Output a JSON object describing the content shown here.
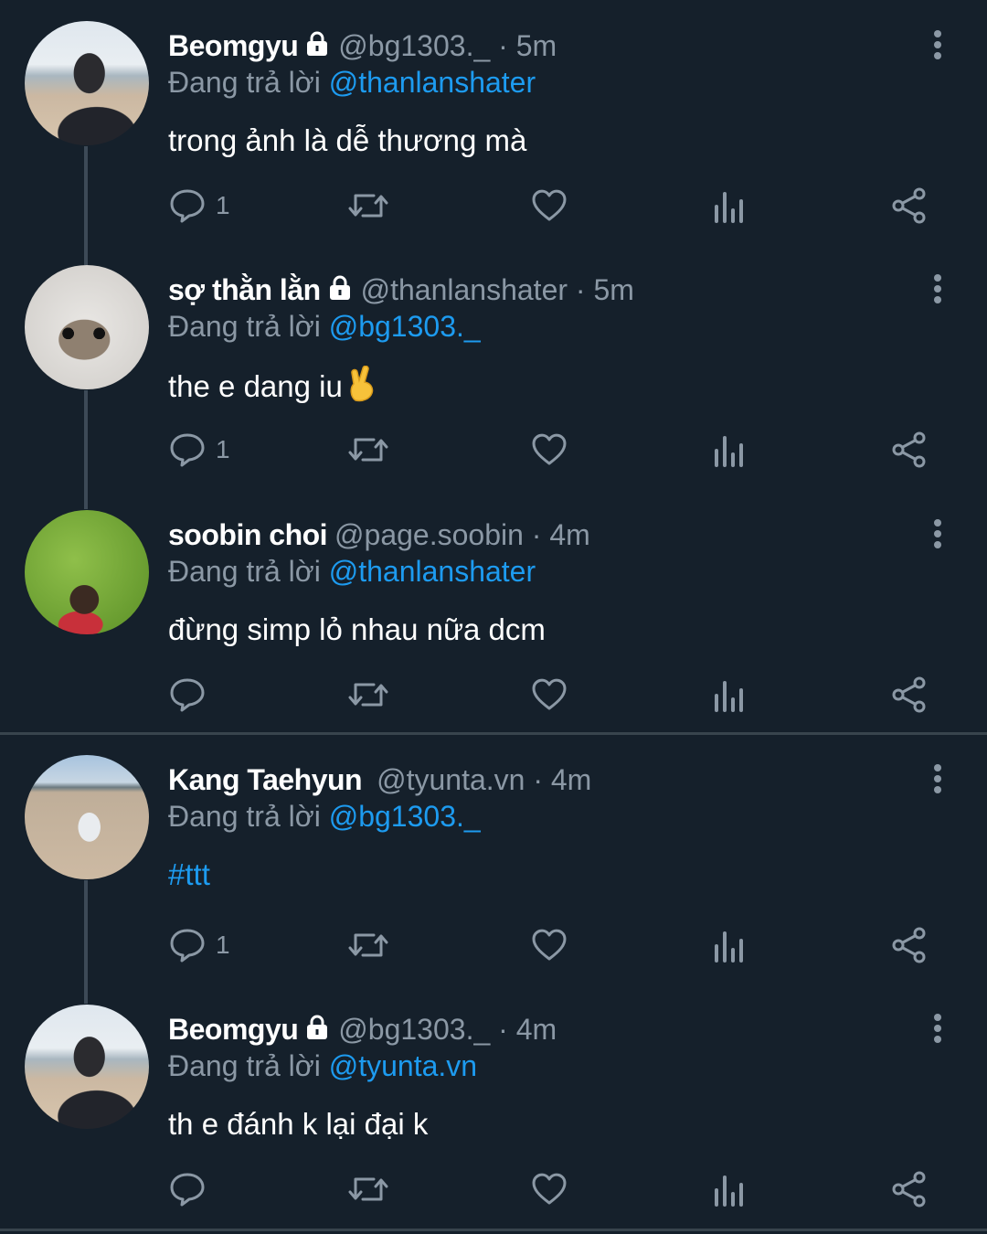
{
  "reply_prefix": "Đang trả lời",
  "tweets": [
    {
      "name": "Beomgyu",
      "locked": true,
      "handle_time": "@bg1303._ · 5m",
      "reply_to": "@thanlanshater",
      "text": "trong ảnh là dễ thương mà",
      "reply_count": "1",
      "avatar": "beach-portrait"
    },
    {
      "name": "sợ thằn lằn",
      "locked": true,
      "handle_time": "@thanlanshater · 5m",
      "reply_to": "@bg1303._",
      "text": "the e dang iu",
      "emoji": "crossed-fingers",
      "reply_count": "1",
      "avatar": "hamster"
    },
    {
      "name": "soobin choi",
      "locked": false,
      "handle_time": "@page.soobin · 4m",
      "reply_to": "@thanlanshater",
      "text": "đừng simp lỏ nhau nữa dcm",
      "reply_count": "",
      "avatar": "grass-photo"
    },
    {
      "name": "Kang Taehyun",
      "locked": false,
      "handle_time": "@tyunta.vn · 4m",
      "reply_to": "@bg1303._",
      "text": "#ttt",
      "reply_count": "1",
      "avatar": "sand-photo"
    },
    {
      "name": "Beomgyu",
      "locked": true,
      "handle_time": "@bg1303._ · 4m",
      "reply_to": "@tyunta.vn",
      "text": "th e đánh k lại đại k",
      "reply_count": "",
      "avatar": "beach-portrait"
    }
  ],
  "icons": {
    "reply": "reply-icon",
    "retweet": "retweet-icon",
    "like": "heart-icon",
    "views": "analytics-icon",
    "share": "share-icon",
    "more": "more-vertical-icon"
  },
  "colors": {
    "background": "#15202b",
    "accent": "#1d9bf0",
    "muted": "#8b98a5",
    "divider": "#38444d"
  }
}
